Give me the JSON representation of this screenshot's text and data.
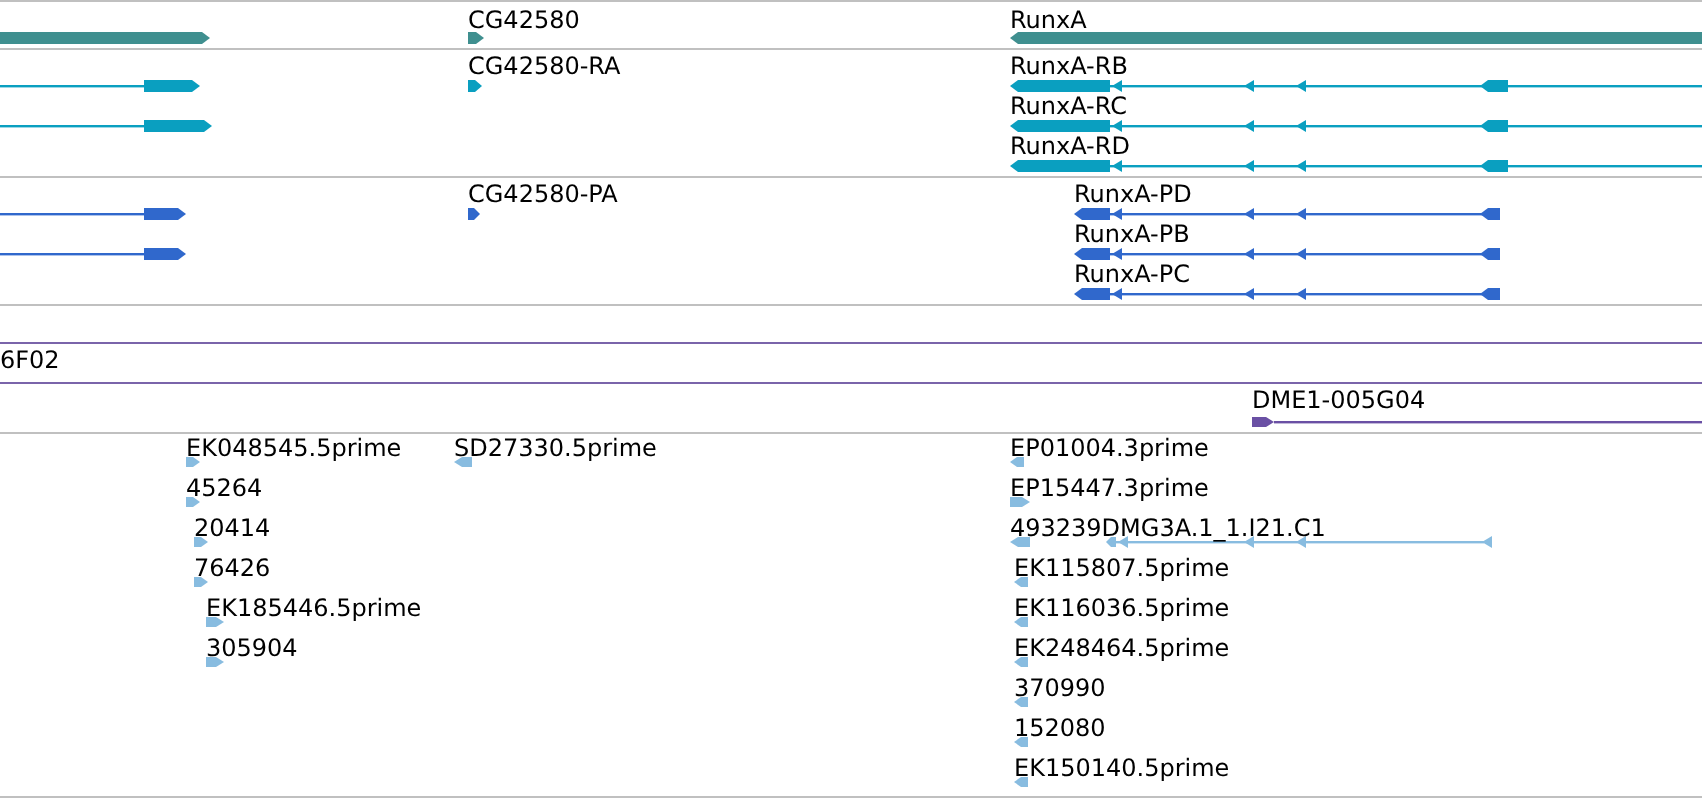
{
  "tracks": [
    {
      "kind": "gene",
      "features": [
        {
          "reverse": false
        },
        {
          "label": "CG42580",
          "reverse": false
        },
        {
          "label": "RunxA",
          "reverse": true
        }
      ]
    },
    {
      "kind": "transcript",
      "features": [
        {
          "reverse": false
        },
        {
          "reverse": false
        },
        {
          "label": "CG42580-RA",
          "reverse": false
        },
        {
          "label": "RunxA-RB",
          "reverse": true
        },
        {
          "label": "RunxA-RC",
          "reverse": true
        },
        {
          "label": "RunxA-RD",
          "reverse": true
        }
      ]
    },
    {
      "kind": "protein",
      "features": [
        {
          "reverse": false
        },
        {
          "reverse": false
        },
        {
          "label": "CG42580-PA",
          "reverse": false
        },
        {
          "label": "RunxA-PD",
          "reverse": true
        },
        {
          "label": "RunxA-PB",
          "reverse": true
        },
        {
          "label": "RunxA-PC",
          "reverse": true
        }
      ]
    },
    {
      "kind": "clone",
      "features": [
        {
          "label": "6F02"
        },
        {
          "label": "DME1-005G04",
          "reverse": false
        }
      ]
    },
    {
      "kind": "est",
      "features": [
        {
          "label": "EK048545.5prime",
          "reverse": false
        },
        {
          "label": "45264",
          "reverse": false
        },
        {
          "label": "20414",
          "reverse": false
        },
        {
          "label": "76426",
          "reverse": false
        },
        {
          "label": "EK185446.5prime",
          "reverse": false
        },
        {
          "label": "305904",
          "reverse": false
        },
        {
          "label": "SD27330.5prime",
          "reverse": true
        },
        {
          "label": "EP01004.3prime",
          "reverse": true
        },
        {
          "label": "EP15447.3prime",
          "reverse": false
        },
        {
          "label": "493239DMG3A.1_1.I21.C1",
          "reverse": true
        },
        {
          "label": "EK115807.5prime",
          "reverse": true
        },
        {
          "label": "EK116036.5prime",
          "reverse": true
        },
        {
          "label": "EK248464.5prime",
          "reverse": true
        },
        {
          "label": "370990",
          "reverse": true
        },
        {
          "label": "152080",
          "reverse": true
        },
        {
          "label": "EK150140.5prime",
          "reverse": true
        }
      ]
    }
  ]
}
